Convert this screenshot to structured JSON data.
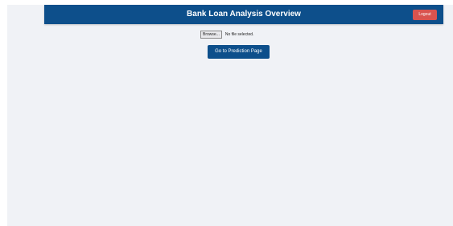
{
  "header": {
    "title": "Bank Loan Analysis Overview",
    "logout_label": "Logout"
  },
  "file_input": {
    "browse_label": "Browse...",
    "status_text": "No file selected."
  },
  "actions": {
    "prediction_button_label": "Go to Prediction Page"
  },
  "colors": {
    "header_bg": "#0d4f8b",
    "logout_bg": "#d9534f",
    "page_bg": "#f0f2f6"
  }
}
